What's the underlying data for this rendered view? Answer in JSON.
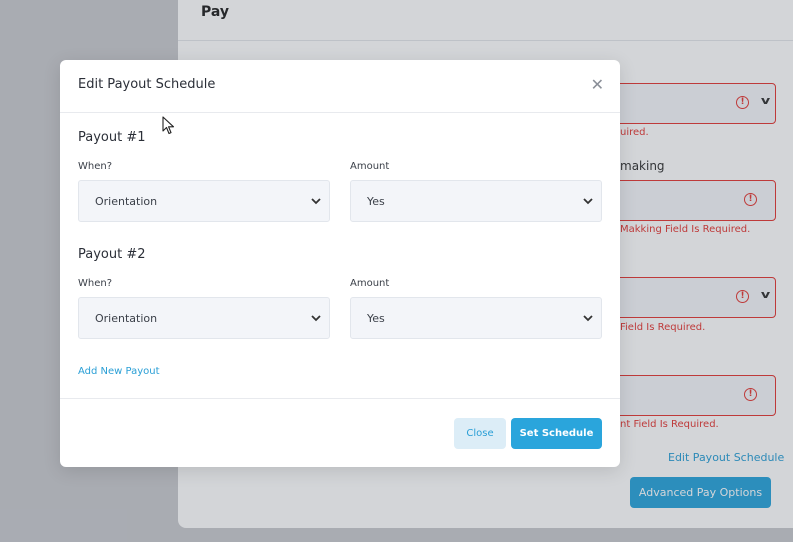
{
  "background": {
    "section_title": "Pay",
    "field_label_making": "making",
    "errors": {
      "e1": "uired.",
      "e2": "Makking Field Is Required.",
      "e3": "Field Is Required.",
      "e4": "nt Field Is Required."
    },
    "edit_link": "Edit Payout Schedule",
    "advanced_button": "Advanced Pay Options",
    "alert_icon": "alert-circle-icon",
    "chevron_icon": "chevron-down-icon"
  },
  "modal": {
    "title": "Edit Payout Schedule",
    "close_icon": "close-icon",
    "payouts": [
      {
        "heading": "Payout #1",
        "when_label": "When?",
        "when_value": "Orientation",
        "amount_label": "Amount",
        "amount_value": "Yes"
      },
      {
        "heading": "Payout #2",
        "when_label": "When?",
        "when_value": "Orientation",
        "amount_label": "Amount",
        "amount_value": "Yes"
      }
    ],
    "add_link": "Add New Payout",
    "close_button": "Close",
    "set_button": "Set Schedule"
  },
  "colors": {
    "accent": "#2aa5dc",
    "error": "#e53935",
    "select_bg": "#f3f5f9"
  }
}
